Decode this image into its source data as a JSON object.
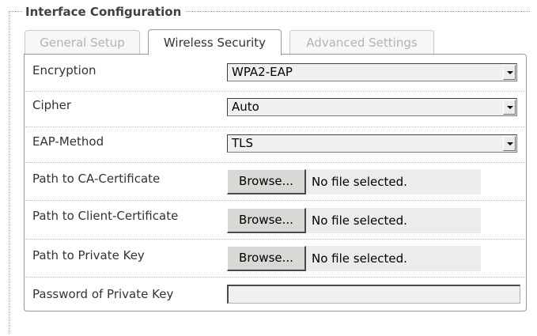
{
  "fieldset": {
    "legend": "Interface Configuration"
  },
  "tabs": [
    {
      "label": "General Setup",
      "active": false,
      "enabled": false
    },
    {
      "label": "Wireless Security",
      "active": true,
      "enabled": true
    },
    {
      "label": "Advanced Settings",
      "active": false,
      "enabled": false
    }
  ],
  "form": {
    "encryption": {
      "label": "Encryption",
      "value": "WPA2-EAP"
    },
    "cipher": {
      "label": "Cipher",
      "value": "Auto"
    },
    "eap_method": {
      "label": "EAP-Method",
      "value": "TLS"
    },
    "ca_certificate": {
      "label": "Path to CA-Certificate",
      "button": "Browse...",
      "status": "No file selected."
    },
    "client_certificate": {
      "label": "Path to Client-Certificate",
      "button": "Browse...",
      "status": "No file selected."
    },
    "private_key": {
      "label": "Path to Private Key",
      "button": "Browse...",
      "status": "No file selected."
    },
    "private_key_password": {
      "label": "Password of Private Key",
      "value": ""
    }
  },
  "icons": {
    "dropdown": "chevron-down-icon"
  },
  "colors": {
    "panel_border": "#999999",
    "inactive_tab_text": "#b3b3b3",
    "field_background": "#f0f0f0"
  }
}
